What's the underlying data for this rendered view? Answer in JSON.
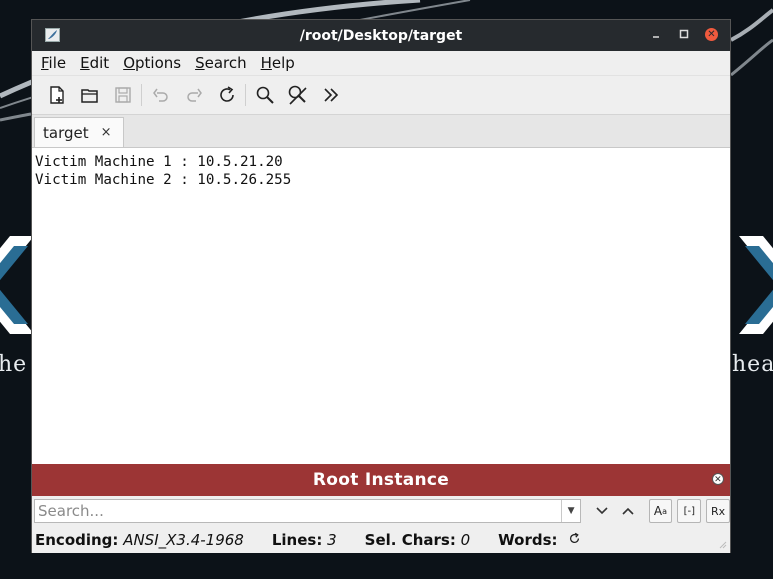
{
  "window": {
    "title": "/root/Desktop/target"
  },
  "menu": [
    {
      "label": "File",
      "accel": "F",
      "rest": "ile"
    },
    {
      "label": "Edit",
      "accel": "E",
      "rest": "dit"
    },
    {
      "label": "Options",
      "accel": "O",
      "rest": "ptions"
    },
    {
      "label": "Search",
      "accel": "S",
      "rest": "earch"
    },
    {
      "label": "Help",
      "accel": "H",
      "rest": "elp"
    }
  ],
  "toolbar": {
    "icons": [
      "new-file-icon",
      "open-file-icon",
      "save-file-icon",
      "undo-icon",
      "redo-icon",
      "reload-icon",
      "search-icon",
      "replace-icon",
      "more-icon"
    ]
  },
  "tabs": [
    {
      "label": "target",
      "close": "×"
    }
  ],
  "editor": {
    "lines": [
      "Victim Machine 1 : 10.5.21.20",
      "Victim Machine 2 : 10.5.26.255"
    ]
  },
  "root_banner": {
    "label": "Root Instance"
  },
  "search": {
    "placeholder": "Search...",
    "value": "",
    "match_case_label": "A",
    "whole_word_label": "[-]",
    "regex_label": "Rx"
  },
  "status": {
    "encoding_label": "Encoding:",
    "encoding_value": "ANSI_X3.4-1968",
    "lines_label": "Lines:",
    "lines_value": "3",
    "selchars_label": "Sel. Chars:",
    "selchars_value": "0",
    "words_label": "Words:"
  },
  "background": {
    "left_text": "he",
    "right_text": "hea"
  },
  "colors": {
    "titlebar": "#262a2e",
    "root_banner": "#9c3535",
    "desktop": "#0c1218",
    "close_button": "#ef5a3e"
  }
}
